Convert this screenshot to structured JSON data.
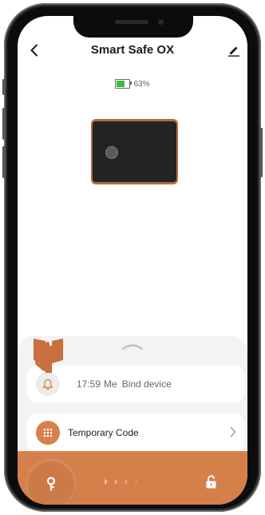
{
  "header": {
    "title": "Smart Safe OX",
    "back_icon": "chevron-left-icon",
    "edit_icon": "pencil-icon"
  },
  "status": {
    "battery_percent": 63,
    "battery_text": "63%"
  },
  "device": {
    "image": "safe-image"
  },
  "log": {
    "icon": "bell-icon",
    "time": "17:59",
    "user": "Me",
    "event": "Bind device"
  },
  "menu": {
    "temporary_code_label": "Temporary Code",
    "temporary_code_icon": "keypad-icon"
  },
  "unlock": {
    "key_icon": "key-icon",
    "slide_chevrons": ">>>>",
    "lock_icon": "unlock-icon"
  },
  "tutorial": {
    "hand_icon": "pointing-hand-icon"
  },
  "colors": {
    "accent": "#d5804b",
    "battery": "#3dbb3d",
    "sheet_background": "#f3f3f3"
  }
}
